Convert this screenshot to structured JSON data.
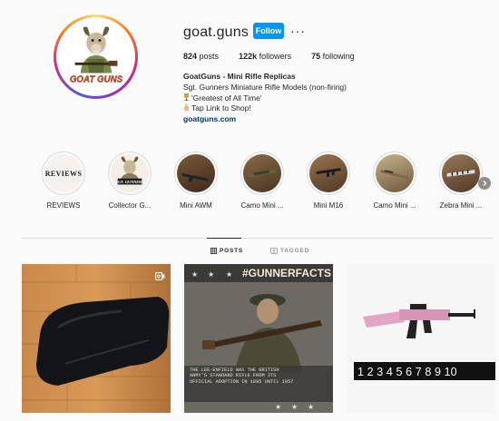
{
  "profile": {
    "username": "goat.guns",
    "follow_label": "Follow",
    "more_label": "···",
    "stats": {
      "posts_count": "824",
      "posts_label": "posts",
      "followers_count": "122k",
      "followers_label": "followers",
      "following_count": "75",
      "following_label": "following"
    },
    "bio": {
      "name": "GoatGuns - Mini Rifle Replicas",
      "line1": "Sgt. Gunners Miniature Rifle Models (non-firing)",
      "line2": "'Greatest of All Time'",
      "line3": "Tap Link to Shop!",
      "link": "goatguns.com"
    },
    "avatar_logo_text": "GOAT GUNS"
  },
  "highlights": [
    {
      "label": "REVIEWS",
      "cover_text": "REVIEWS"
    },
    {
      "label": "Collector G...",
      "cover_text": "SGT. GUNNERS"
    },
    {
      "label": "Mini AWM"
    },
    {
      "label": "Camo Mini ..."
    },
    {
      "label": "Mini M16"
    },
    {
      "label": "Camo Mini ..."
    },
    {
      "label": "Zebra Mini ..."
    }
  ],
  "tabs": [
    {
      "label": "POSTS",
      "icon": "grid-icon"
    },
    {
      "label": "TAGGED",
      "icon": "tag-icon"
    }
  ],
  "posts": {
    "post2_heading": "#GUNNERFACTS",
    "post2_caption": "THE LEE-ENFIELD WAS THE BRITISH ARMY'S STANDARD RIFLE FROM ITS OFFICIAL ADOPTION IN 1895 UNTIL 1957",
    "post3_ruler_digits": "1 2 3 4 5 6 7 8 9 10"
  },
  "colors": {
    "follow_blue": "#0095f6",
    "link_blue": "#00376b",
    "ring_gradient_start": "#feda75",
    "ring_gradient_end": "#962fbf"
  }
}
